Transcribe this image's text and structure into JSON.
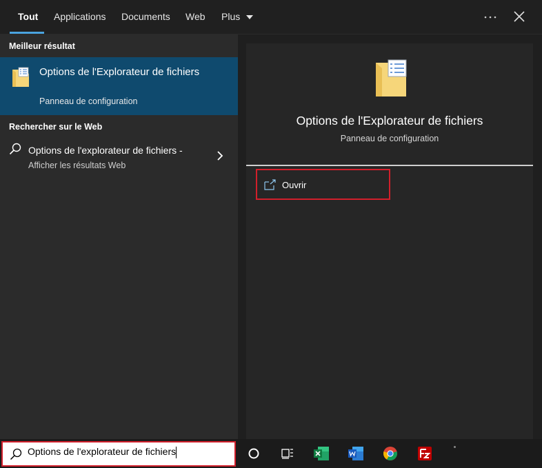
{
  "tabs": [
    {
      "label": "Tout",
      "active": true
    },
    {
      "label": "Applications"
    },
    {
      "label": "Documents"
    },
    {
      "label": "Web"
    },
    {
      "label": "Plus"
    }
  ],
  "header_icons": [
    "more-options-icon",
    "close-icon"
  ],
  "left": {
    "best_heading": "Meilleur résultat",
    "best_result": {
      "title": "Options de l'Explorateur de fichiers",
      "subtitle": "Panneau de configuration",
      "icon": "folder-options-icon"
    },
    "web_heading": "Rechercher sur le Web",
    "web_result": {
      "title": "Options de l'explorateur de fichiers -",
      "subtitle": "Afficher les résultats Web",
      "icon": "search-icon"
    }
  },
  "preview": {
    "title": "Options de l'Explorateur de fichiers",
    "subtitle": "Panneau de configuration",
    "actions": [
      {
        "label": "Ouvrir",
        "icon": "open-icon"
      }
    ]
  },
  "taskbar": {
    "search_value": "Options de l'explorateur de fichiers",
    "items": [
      "cortana-icon",
      "task-view-icon",
      "excel-icon",
      "word-icon",
      "chrome-icon",
      "filezilla-icon"
    ]
  },
  "colors": {
    "accent": "#4aa3df",
    "selected_bg": "#0f4a6e",
    "highlight_border": "#d21f2b",
    "folder": "#f6d67a"
  }
}
